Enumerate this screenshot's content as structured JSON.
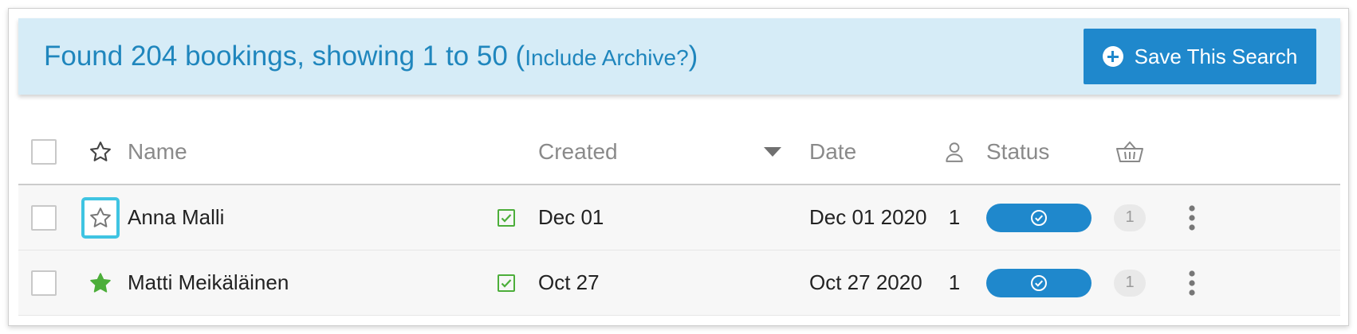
{
  "banner": {
    "summary": "Found 204 bookings, showing 1 to 50 (",
    "archive_link": "Include Archive?",
    "close_paren": ")",
    "save_button_label": "Save This Search",
    "save_button_icon": "plus-circle-icon"
  },
  "table": {
    "headers": {
      "star_icon": "star-outline-icon",
      "name": "Name",
      "created": "Created",
      "sort_icon": "caret-down-icon",
      "date": "Date",
      "people_icon": "person-icon",
      "status": "Status",
      "basket_icon": "basket-icon"
    },
    "rows": [
      {
        "starred": false,
        "name": "Anna Malli",
        "confirmed_icon": "checkbox-checked-icon",
        "created": "Dec 01",
        "date": "Dec 01 2020",
        "people": "1",
        "status_icon": "check-circle-icon",
        "items_count": "1",
        "more_icon": "more-vertical-icon"
      },
      {
        "starred": true,
        "name": "Matti Meikäläinen",
        "confirmed_icon": "checkbox-checked-icon",
        "created": "Oct 27",
        "date": "Oct 27 2020",
        "people": "1",
        "status_icon": "check-circle-icon",
        "items_count": "1",
        "more_icon": "more-vertical-icon"
      }
    ]
  },
  "colors": {
    "banner_bg": "#d6ecf7",
    "accent_blue": "#1f88cc",
    "focus_ring": "#3fc4e2",
    "star_green": "#4cae3a",
    "check_green": "#4cae3a"
  }
}
